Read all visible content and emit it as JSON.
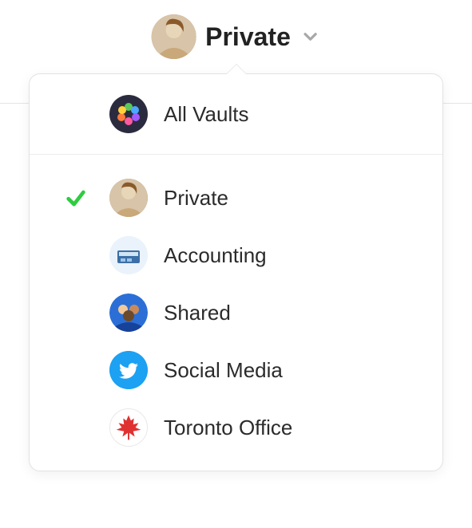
{
  "selector": {
    "current_vault_label": "Private",
    "avatar_icon": "user-avatar"
  },
  "dropdown": {
    "all_vaults_label": "All Vaults",
    "vaults": [
      {
        "label": "Private",
        "icon": "user-avatar",
        "selected": true
      },
      {
        "label": "Accounting",
        "icon": "accounting-icon",
        "selected": false
      },
      {
        "label": "Shared",
        "icon": "shared-icon",
        "selected": false
      },
      {
        "label": "Social Media",
        "icon": "twitter-icon",
        "selected": false
      },
      {
        "label": "Toronto Office",
        "icon": "maple-leaf-icon",
        "selected": false
      }
    ]
  },
  "colors": {
    "check": "#2ecc40",
    "twitter_blue": "#1da1f2",
    "maple_red": "#e03131"
  }
}
